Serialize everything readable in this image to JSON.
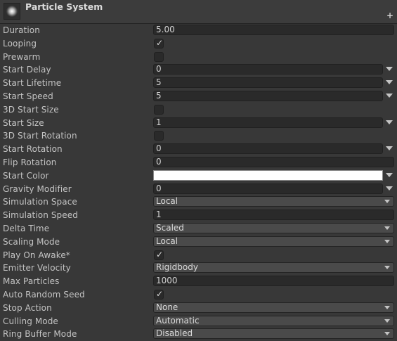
{
  "header": {
    "title": "Particle System",
    "add_icon": "+"
  },
  "rows": [
    {
      "label": "Duration",
      "kind": "field",
      "value": "5.00"
    },
    {
      "label": "Looping",
      "kind": "checkbox",
      "checked": true
    },
    {
      "label": "Prewarm",
      "kind": "checkbox",
      "checked": false
    },
    {
      "label": "Start Delay",
      "kind": "field-dd",
      "value": "0"
    },
    {
      "label": "Start Lifetime",
      "kind": "field-dd",
      "value": "5"
    },
    {
      "label": "Start Speed",
      "kind": "field-dd",
      "value": "5"
    },
    {
      "label": "3D Start Size",
      "kind": "checkbox",
      "checked": false
    },
    {
      "label": "Start Size",
      "kind": "field-dd",
      "value": "1"
    },
    {
      "label": "3D Start Rotation",
      "kind": "checkbox",
      "checked": false
    },
    {
      "label": "Start Rotation",
      "kind": "field-dd",
      "value": "0"
    },
    {
      "label": "Flip Rotation",
      "kind": "field",
      "value": "0"
    },
    {
      "label": "Start Color",
      "kind": "color",
      "color": "#ffffff"
    },
    {
      "label": "Gravity Modifier",
      "kind": "field-dd",
      "value": "0"
    },
    {
      "label": "Simulation Space",
      "kind": "popup",
      "value": "Local"
    },
    {
      "label": "Simulation Speed",
      "kind": "field",
      "value": "1"
    },
    {
      "label": "Delta Time",
      "kind": "popup",
      "value": "Scaled"
    },
    {
      "label": "Scaling Mode",
      "kind": "popup",
      "value": "Local"
    },
    {
      "label": "Play On Awake*",
      "kind": "checkbox",
      "checked": true
    },
    {
      "label": "Emitter Velocity",
      "kind": "popup",
      "value": "Rigidbody"
    },
    {
      "label": "Max Particles",
      "kind": "field",
      "value": "1000"
    },
    {
      "label": "Auto Random Seed",
      "kind": "checkbox",
      "checked": true
    },
    {
      "label": "Stop Action",
      "kind": "popup",
      "value": "None"
    },
    {
      "label": "Culling Mode",
      "kind": "popup",
      "value": "Automatic"
    },
    {
      "label": "Ring Buffer Mode",
      "kind": "popup",
      "value": "Disabled"
    }
  ],
  "check_glyph": "✓"
}
